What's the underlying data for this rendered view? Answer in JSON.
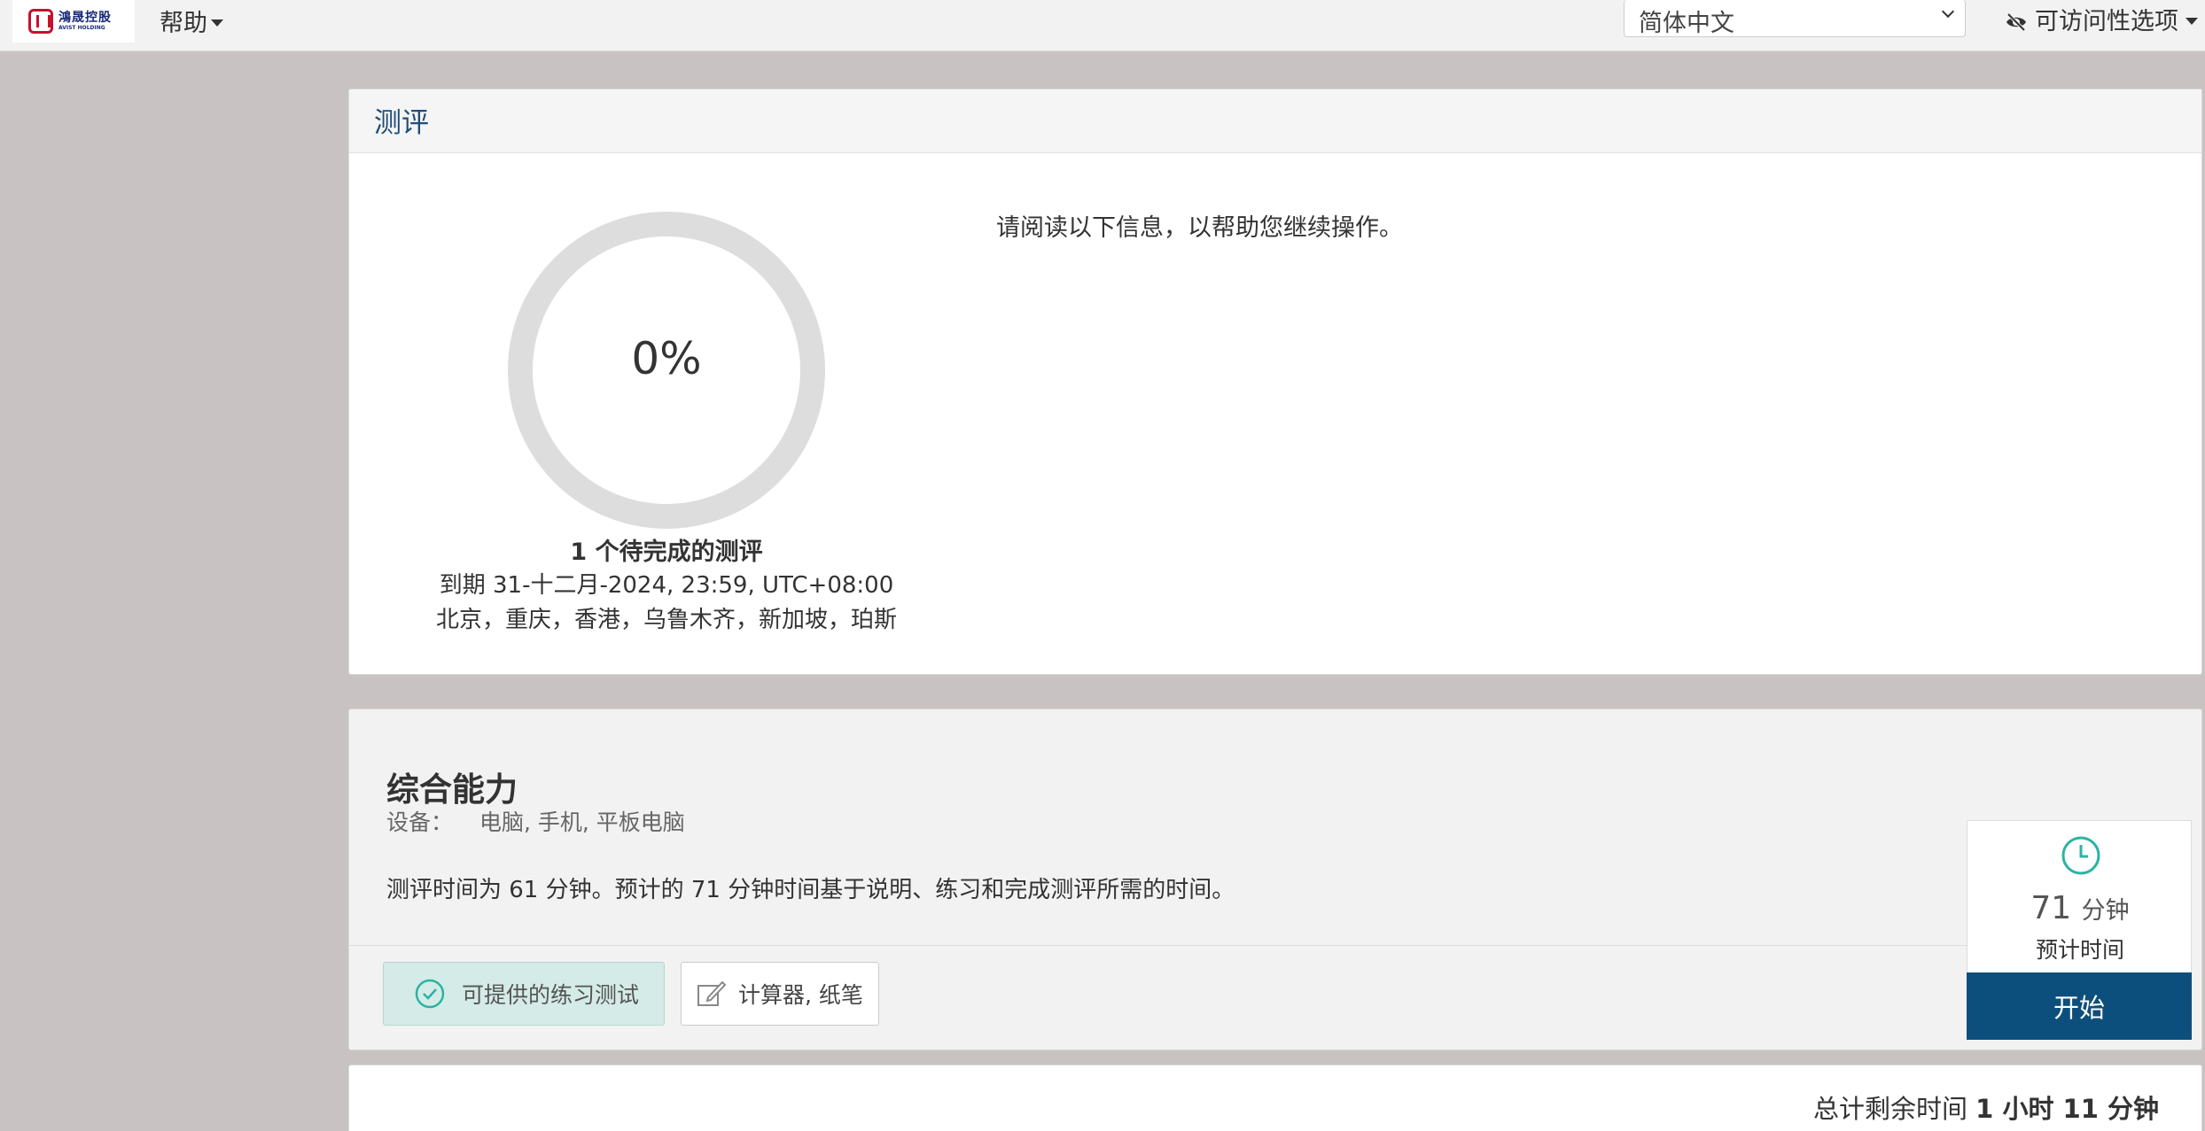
{
  "header": {
    "logo_cn": "鴻晟控股",
    "logo_en": "AVIST HOLDING",
    "help_label": "帮助",
    "language": "简体中文",
    "accessibility_label": "可访问性选项"
  },
  "assessment": {
    "title": "测评",
    "progress_percent": 0,
    "progress_label": "0%",
    "pending": "1 个待完成的测评",
    "due": "到期 31-十二月-2024, 23:59, UTC+08:00",
    "timezone": "北京，重庆，香港，乌鲁木齐，新加坡，珀斯",
    "info": "请阅读以下信息，以帮助您继续操作。"
  },
  "section": {
    "title": "综合能力",
    "device_label": "设备：",
    "devices": "电脑, 手机, 平板电脑",
    "description": "测评时间为 61 分钟。预计的 71 分钟时间基于说明、练习和完成测评所需的时间。",
    "practice_tag": "可提供的练习测试",
    "tools_tag": "计算器, 纸笔",
    "estimate_minutes": "71",
    "estimate_unit": "分钟",
    "estimate_label": "预计时间",
    "start_label": "开始"
  },
  "footer": {
    "remaining_label": "总计剩余时间",
    "remaining_value": "1 小时 11 分钟"
  },
  "colors": {
    "accent": "#0d4f7c",
    "teal": "#2bb3a3",
    "ring": "#dddddd"
  }
}
